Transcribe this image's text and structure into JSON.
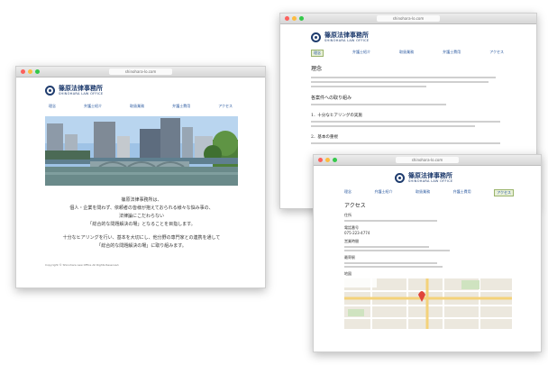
{
  "w1": {
    "url": "shinohara-lo.com",
    "logo_jp": "篠原法律事務所",
    "logo_en": "SHINOHARA LAW OFFICE",
    "nav": [
      "理念",
      "弁護士紹介",
      "取扱業務",
      "弁護士費用",
      "アクセス"
    ],
    "intro_1": "篠原法律事務所は、",
    "intro_2": "個人・企業を問わず、依頼者の皆様が抱えておられる様々な悩み事の、",
    "intro_3": "法律論にこだわらない",
    "intro_4": "「総合的な問題解決の場」となることを目指します。",
    "intro_5": "十分なヒアリングを行い、基本を大切にし、他分野の専門家との連携を通して",
    "intro_6": "「総合的な問題解決の場」に取り組みます。",
    "footer": "Copyright © Shinohara Law Office All Rights Reserved."
  },
  "w2": {
    "url": "shinohara-lo.com",
    "logo_jp": "篠原法律事務所",
    "logo_en": "SHINOHARA LAW OFFICE",
    "nav": [
      "理念",
      "弁護士紹介",
      "取扱業務",
      "弁護士費用",
      "アクセス"
    ],
    "title": "理念",
    "sec1": "各案件への取り組み",
    "item1": "1．十分なヒアリングの実施",
    "item2": "2．基本の重視"
  },
  "w3": {
    "url": "shinohara-lo.com",
    "logo_jp": "篠原法律事務所",
    "logo_en": "SHINOHARA LAW OFFICE",
    "nav": [
      "理念",
      "弁護士紹介",
      "取扱業務",
      "弁護士費用",
      "アクセス"
    ],
    "title": "アクセス",
    "h_address": "住所",
    "h_tel": "電話番号",
    "tel": "075-223-4774",
    "h_hours": "営業時間",
    "h_station": "最寄駅",
    "h_map": "地図"
  }
}
